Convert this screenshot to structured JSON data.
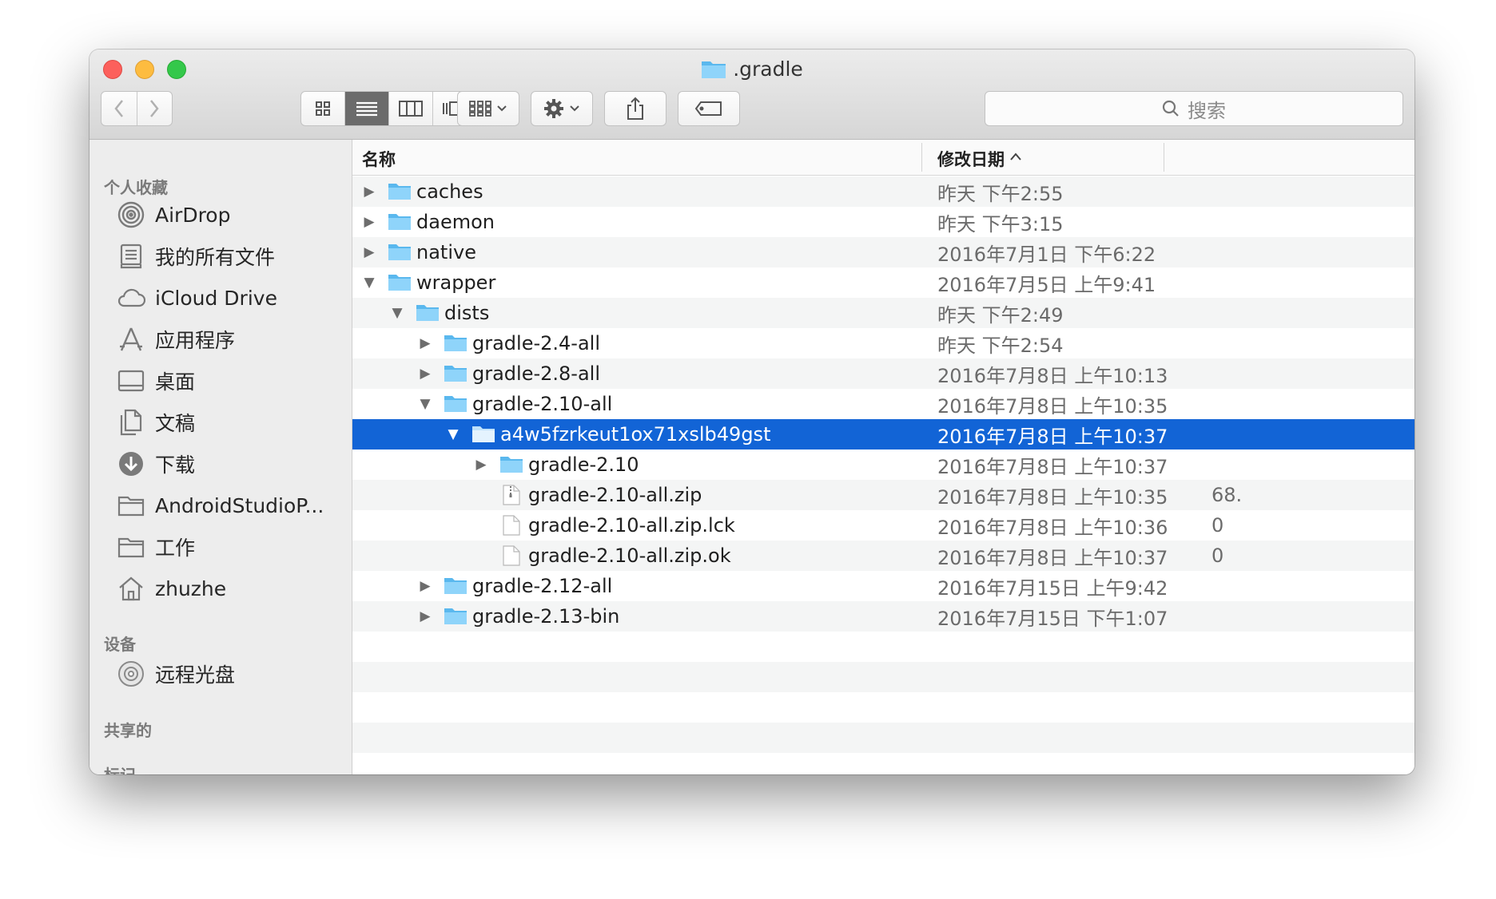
{
  "window": {
    "title": ".gradle"
  },
  "toolbar": {
    "view_modes": [
      "icon-view",
      "list-view",
      "column-view",
      "cover-flow-view"
    ],
    "active_view": "list-view",
    "search_placeholder": "搜索"
  },
  "sidebar": {
    "sections": [
      {
        "title": "个人收藏",
        "items": [
          {
            "label": "AirDrop",
            "icon": "airdrop-icon"
          },
          {
            "label": "我的所有文件",
            "icon": "all-files-icon"
          },
          {
            "label": "iCloud Drive",
            "icon": "cloud-icon"
          },
          {
            "label": "应用程序",
            "icon": "applications-icon"
          },
          {
            "label": "桌面",
            "icon": "desktop-icon"
          },
          {
            "label": "文稿",
            "icon": "documents-icon"
          },
          {
            "label": "下载",
            "icon": "download-icon"
          },
          {
            "label": "AndroidStudioP...",
            "icon": "folder-icon"
          },
          {
            "label": "工作",
            "icon": "folder-icon"
          },
          {
            "label": "zhuzhe",
            "icon": "home-icon"
          }
        ]
      },
      {
        "title": "设备",
        "items": [
          {
            "label": "远程光盘",
            "icon": "disc-icon"
          }
        ]
      },
      {
        "title": "共享的",
        "items": []
      },
      {
        "title": "标记",
        "items": []
      }
    ]
  },
  "columns": {
    "name": "名称",
    "date": "修改日期"
  },
  "files": [
    {
      "name": "caches",
      "date": "昨天 下午2:55",
      "size": "",
      "disclosure": "closed",
      "kind": "folder"
    },
    {
      "name": "daemon",
      "date": "昨天 下午3:15",
      "size": "",
      "disclosure": "closed",
      "kind": "folder"
    },
    {
      "name": "native",
      "date": "2016年7月1日 下午6:22",
      "size": "",
      "disclosure": "closed",
      "kind": "folder"
    },
    {
      "name": "wrapper",
      "date": "2016年7月5日 上午9:41",
      "size": "",
      "disclosure": "open",
      "kind": "folder"
    },
    {
      "name": "dists",
      "date": "昨天 下午2:49",
      "size": "",
      "disclosure": "open",
      "kind": "folder"
    },
    {
      "name": "gradle-2.4-all",
      "date": "昨天 下午2:54",
      "size": "",
      "disclosure": "closed",
      "kind": "folder"
    },
    {
      "name": "gradle-2.8-all",
      "date": "2016年7月8日 上午10:13",
      "size": "",
      "disclosure": "closed",
      "kind": "folder"
    },
    {
      "name": "gradle-2.10-all",
      "date": "2016年7月8日 上午10:35",
      "size": "",
      "disclosure": "open",
      "kind": "folder"
    },
    {
      "name": "a4w5fzrkeut1ox71xslb49gst",
      "date": "2016年7月8日 上午10:37",
      "size": "",
      "disclosure": "open",
      "kind": "folder",
      "selected": true
    },
    {
      "name": "gradle-2.10",
      "date": "2016年7月8日 上午10:37",
      "size": "",
      "disclosure": "closed",
      "kind": "folder"
    },
    {
      "name": "gradle-2.10-all.zip",
      "date": "2016年7月8日 上午10:35",
      "size": "68.",
      "disclosure": "none",
      "kind": "zip"
    },
    {
      "name": "gradle-2.10-all.zip.lck",
      "date": "2016年7月8日 上午10:36",
      "size": "0",
      "disclosure": "none",
      "kind": "file"
    },
    {
      "name": "gradle-2.10-all.zip.ok",
      "date": "2016年7月8日 上午10:37",
      "size": "0",
      "disclosure": "none",
      "kind": "file"
    },
    {
      "name": "gradle-2.12-all",
      "date": "2016年7月15日 上午9:42",
      "size": "",
      "disclosure": "closed",
      "kind": "folder"
    },
    {
      "name": "gradle-2.13-bin",
      "date": "2016年7月15日 下午1:07",
      "size": "",
      "disclosure": "closed",
      "kind": "folder"
    }
  ],
  "colors": {
    "selection": "#1264d6",
    "folder": "#6cc4f4",
    "stripe": "#f4f5f5"
  }
}
